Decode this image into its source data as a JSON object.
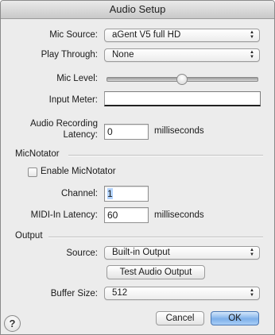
{
  "window": {
    "title": "Audio Setup"
  },
  "audio": {
    "mic_source_label": "Mic Source:",
    "mic_source_value": "aGent V5 full HD",
    "play_through_label": "Play Through:",
    "play_through_value": "None",
    "mic_level_label": "Mic Level:",
    "mic_level_fraction": 0.5,
    "input_meter_label": "Input Meter:",
    "latency_label_line1": "Audio Recording",
    "latency_label_line2": "Latency:",
    "latency_value": "0",
    "latency_unit": "milliseconds"
  },
  "micnotator": {
    "section_title": "MicNotator",
    "enable_label": "Enable MicNotator",
    "enable_checked": false,
    "channel_label": "Channel:",
    "channel_value": "1",
    "midi_latency_label": "MIDI-In Latency:",
    "midi_latency_value": "60",
    "midi_latency_unit": "milliseconds"
  },
  "output": {
    "section_title": "Output",
    "source_label": "Source:",
    "source_value": "Built-in Output",
    "test_button_label": "Test Audio Output",
    "buffer_label": "Buffer Size:",
    "buffer_value": "512"
  },
  "footer": {
    "help_glyph": "?",
    "cancel_label": "Cancel",
    "ok_label": "OK"
  },
  "icons": {
    "popup_arrows": "updown-arrows-icon",
    "help": "help-icon"
  },
  "colors": {
    "window_bg": "#ececec",
    "default_button": "#7eb0ea",
    "selection": "#b5d5ff"
  }
}
